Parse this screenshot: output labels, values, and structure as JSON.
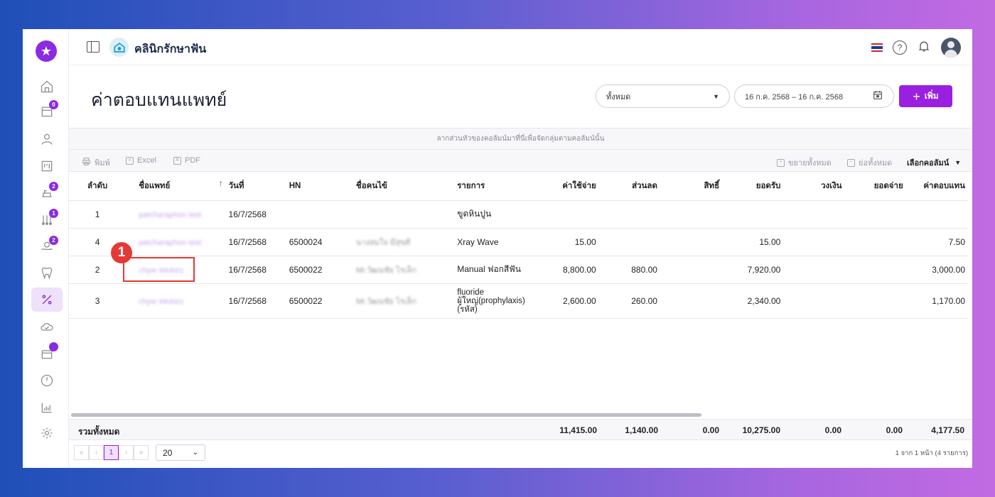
{
  "app": {
    "clinic_name": "คลินิกรักษาฟัน",
    "page_title": "ค่าตอบแทนแพทย์"
  },
  "sidebar": {
    "items": [
      {
        "icon": "home-icon",
        "badge": null
      },
      {
        "icon": "calendar-icon",
        "badge": "0"
      },
      {
        "icon": "user-icon",
        "badge": null
      },
      {
        "icon": "board-icon",
        "badge": null
      },
      {
        "icon": "dental-chair-icon",
        "badge": "2"
      },
      {
        "icon": "tools-icon",
        "badge": "1"
      },
      {
        "icon": "hand-coin-icon",
        "badge": "2"
      },
      {
        "icon": "tooth-icon",
        "badge": null
      },
      {
        "icon": "percent-icon",
        "badge": null,
        "active": true
      },
      {
        "icon": "cloud-check-icon",
        "badge": null
      },
      {
        "icon": "box-icon",
        "badge": ""
      },
      {
        "icon": "gauge-icon",
        "badge": null
      },
      {
        "icon": "chart-icon",
        "badge": null
      },
      {
        "icon": "gear-icon",
        "badge": null
      }
    ]
  },
  "filters": {
    "doctor_select": "ทั้งหมด",
    "date_range": "16 ก.ค. 2568 – 16 ก.ค. 2568",
    "add_label": "เพิ่ม"
  },
  "toolbar": {
    "group_hint": "ลากส่วนหัวของคอลัมน์มาที่นี่เพื่อจัดกลุ่มตามคอลัมน์นั้น",
    "print": "พิมพ์",
    "excel": "Excel",
    "pdf": "PDF",
    "expand_all": "ขยายทั้งหมด",
    "collapse_all": "ย่อทั้งหมด",
    "choose_columns": "เลือกคอลัมน์"
  },
  "table": {
    "columns": [
      "ลำดับ",
      "ชื่อแพทย์",
      "วันที่",
      "HN",
      "ชื่อคนไข้",
      "รายการ",
      "ค่าใช้จ่าย",
      "ส่วนลด",
      "สิทธิ์",
      "ยอดรับ",
      "วงเงิน",
      "ยอดจ่าย",
      "ค่าตอบแทน"
    ],
    "rows": [
      {
        "no": "1",
        "doctor": "patcharaphon test",
        "date": "16/7/2568",
        "hn": "",
        "patient": "",
        "item": "ขูดหินปูน",
        "cost": "",
        "discount": "",
        "right": "",
        "received": "",
        "limit": "",
        "paid": "",
        "fee": ""
      },
      {
        "no": "4",
        "doctor": "patcharaphon test",
        "date": "16/7/2568",
        "hn": "6500024",
        "patient": "นางสมใจ มีสุขดี",
        "item": "Xray Wave",
        "cost": "15.00",
        "discount": "",
        "right": "",
        "received": "15.00",
        "limit": "",
        "paid": "",
        "fee": "7.50"
      },
      {
        "no": "2",
        "doctor": "chyw ทดสอบ",
        "date": "16/7/2568",
        "hn": "6500022",
        "patient": "Mr.วัฒนชัย โรเล็ก",
        "item": "Manual ฟอกสีฟัน",
        "cost": "8,800.00",
        "discount": "880.00",
        "right": "",
        "received": "7,920.00",
        "limit": "",
        "paid": "",
        "fee": "3,000.00"
      },
      {
        "no": "3",
        "doctor": "chyw ทดสอบ",
        "date": "16/7/2568",
        "hn": "6500022",
        "patient": "Mr.วัฒนชัย โรเล็ก",
        "item_lines": [
          "fluoride",
          "ผู้ใหญ่(prophylaxis)",
          "(รหัส)"
        ],
        "cost": "2,600.00",
        "discount": "260.00",
        "right": "",
        "received": "2,340.00",
        "limit": "",
        "paid": "",
        "fee": "1,170.00"
      }
    ],
    "totals": {
      "label": "รวมทั้งหมด",
      "cost": "11,415.00",
      "discount": "1,140.00",
      "right": "0.00",
      "received": "10,275.00",
      "limit": "0.00",
      "paid": "0.00",
      "fee": "4,177.50"
    }
  },
  "pagination": {
    "current_page": "1",
    "page_size": "20",
    "info": "1 จาก 1 หน้า (4 รายการ)"
  },
  "annotation": {
    "marker": "1"
  },
  "colors": {
    "accent": "#9b1fe0",
    "highlight": "#e53935"
  }
}
